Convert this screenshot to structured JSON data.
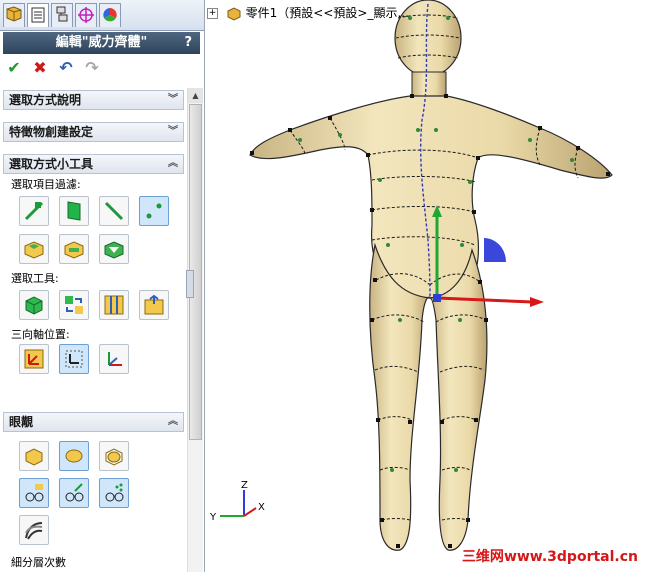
{
  "property_manager": {
    "tabs": [
      "feature-manager",
      "property-manager",
      "configuration-manager",
      "dimxpert-manager",
      "display-manager"
    ],
    "title": "編輯\"威力齊體\"",
    "help": "?",
    "actions": {
      "ok": "✔",
      "cancel": "✖",
      "undo": "↶",
      "redo": "↷"
    }
  },
  "sections": {
    "selection_help": "選取方式說明",
    "feature_settings": "特徵物創建設定",
    "selection_tools": "選取方式小工具",
    "filter_label": "選取項目過濾:",
    "tools_label": "選取工具:",
    "triad_label": "三向軸位置:",
    "display": "眼覯",
    "subdivision": "細分層次數"
  },
  "tree": {
    "expand": "+",
    "label": "零件1（預設<<預設>_顯示..."
  },
  "triad": {
    "x": "X",
    "y": "Y",
    "z": "Z"
  },
  "watermark": {
    "cn": "三维网",
    "url": "www.3dportal.cn"
  },
  "colors": {
    "title_bar": "#2f445c",
    "body": "#ecdcae",
    "select_blue": "#cfe6fb",
    "cage_green": "#2d8a3a"
  }
}
